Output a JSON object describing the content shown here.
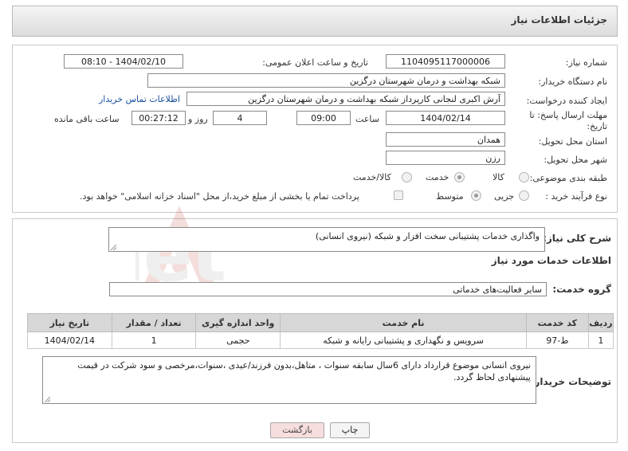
{
  "header": {
    "title": "جزئیات اطلاعات نیاز"
  },
  "fields": {
    "need_number_label": "شماره نیاز:",
    "need_number": "1104095117000006",
    "announce_label": "تاریخ و ساعت اعلان عمومی:",
    "announce_value": "1404/02/10 - 08:10",
    "buyer_org_label": "نام دستگاه خریدار:",
    "buyer_org": "شبکه بهداشت و درمان شهرستان درگزین",
    "requester_label": "ایجاد کننده درخواست:",
    "requester": "آرش اکبری لنجانی کارپرداز شبکه بهداشت و درمان شهرستان درگزین",
    "contact_link": "اطلاعات تماس خریدار",
    "deadline_label_1": "مهلت ارسال پاسخ: تا",
    "deadline_label_2": "تاریخ:",
    "deadline_date": "1404/02/14",
    "time_label": "ساعت",
    "deadline_time": "09:00",
    "days_value": "4",
    "days_label": "روز و",
    "remaining_time": "00:27:12",
    "remaining_label": "ساعت باقی مانده",
    "province_label": "استان محل تحویل:",
    "province": "همدان",
    "city_label": "شهر محل تحویل:",
    "city": "رزن",
    "category_label": "طبقه بندی موضوعی:",
    "category_options": [
      "کالا",
      "خدمت",
      "کالا/خدمت"
    ],
    "category_selected": "خدمت",
    "purchase_type_label": "نوع فرآیند خرید :",
    "purchase_options": [
      "جزیی",
      "متوسط"
    ],
    "purchase_selected": "متوسط",
    "treasury_note": "پرداخت تمام یا بخشی از مبلغ خرید،از محل \"اسناد خزانه اسلامی\" خواهد بود."
  },
  "summary": {
    "label": "شرح کلی نیاز:",
    "text": "واگذاری خدمات پشتیبانی سخت افزار و شبکه (نیروی انسانی)"
  },
  "services": {
    "section_title": "اطلاعات خدمات مورد نیاز",
    "group_label": "گروه خدمت:",
    "group_value": "سایر فعالیت‌های خدماتی",
    "columns": [
      "ردیف",
      "کد خدمت",
      "نام خدمت",
      "واحد اندازه گیری",
      "تعداد / مقدار",
      "تاریخ نیاز"
    ],
    "rows": [
      [
        "1",
        "ط-97",
        "سرویس و نگهداری و پشتیبانی رایانه و شبکه",
        "حجمی",
        "1",
        "1404/02/14"
      ]
    ]
  },
  "buyer_notes": {
    "label": "توضیحات خریدار:",
    "text": "نیروی انسانی موضوع قرارداد دارای 6سال سابقه سنوات ، متاهل،بدون فرزند/عیدی ،سنوات،مرخصی و سود شرکت در قیمت پیشنهادی لحاظ گردد."
  },
  "buttons": {
    "print": "چاپ",
    "back": "بازگشت"
  },
  "watermark_text": "AriaTender.net",
  "colors": {
    "link": "#1a4fa0",
    "back_button_bg": "#f7dede",
    "watermark": "#c0392b"
  }
}
